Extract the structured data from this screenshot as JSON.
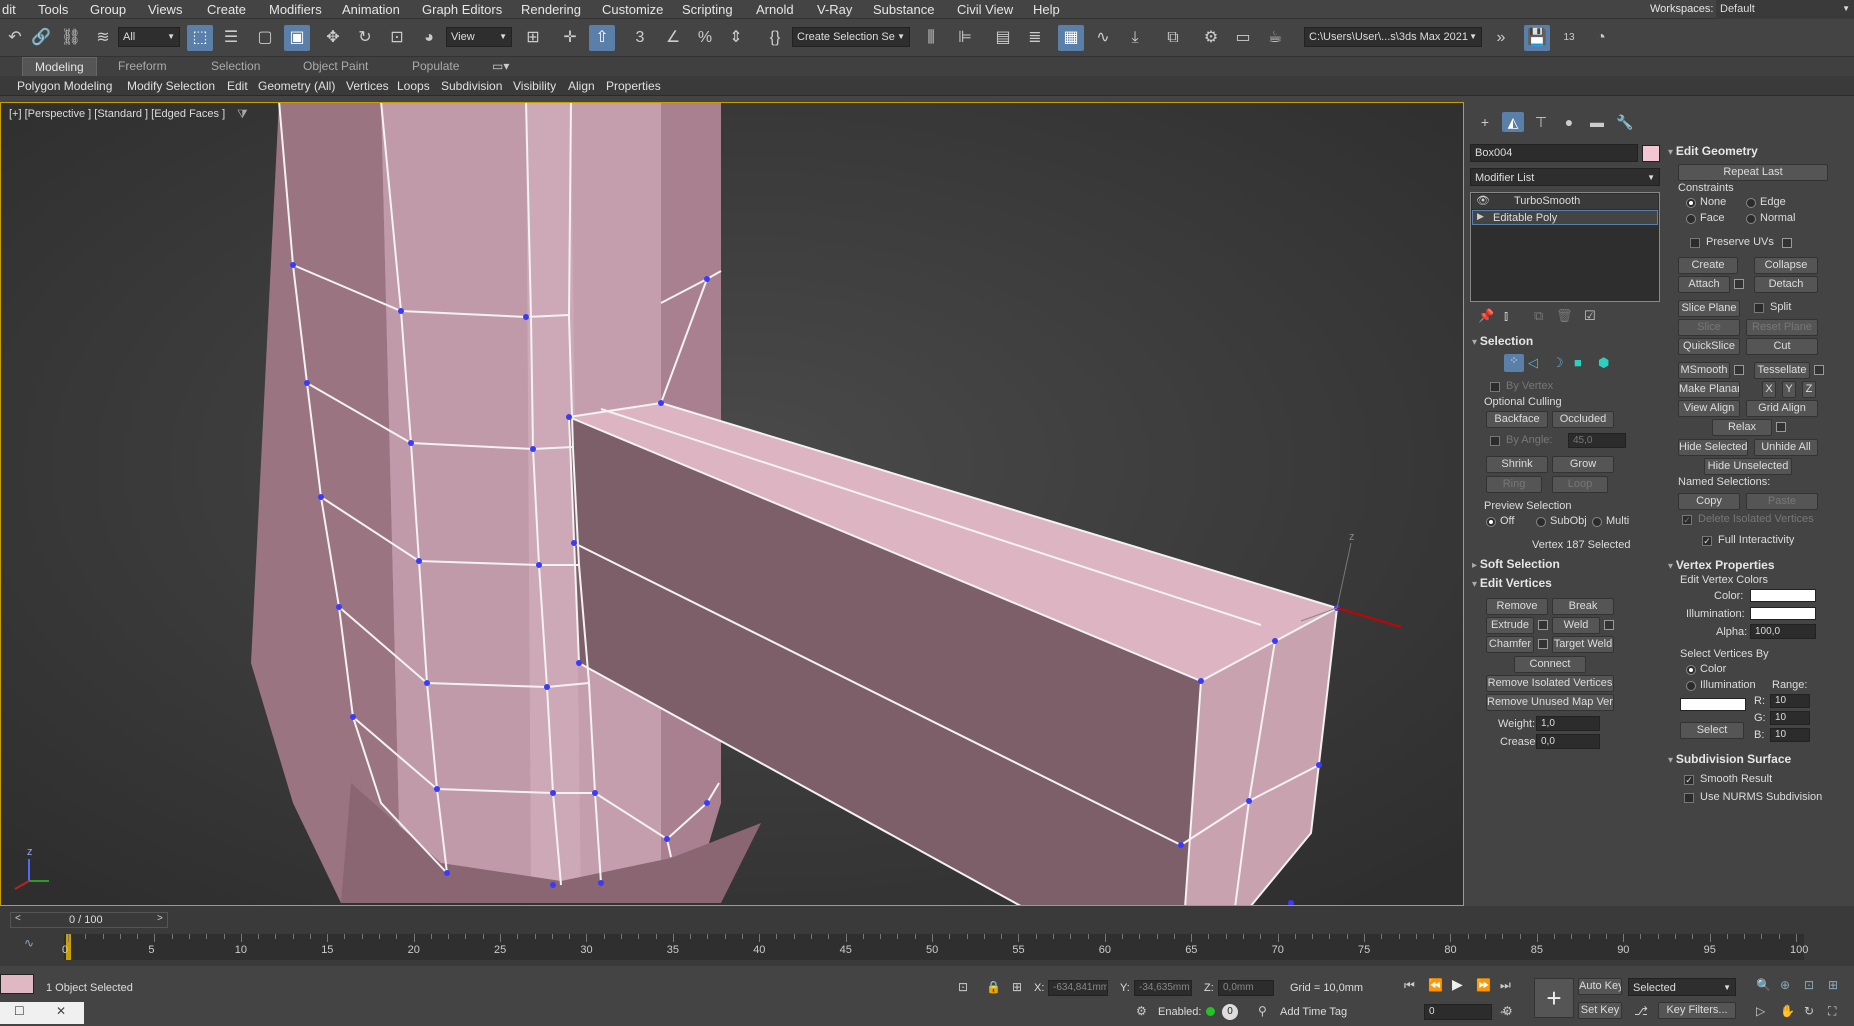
{
  "menubar": {
    "items": [
      "dit",
      "Tools",
      "Group",
      "Views",
      "Create",
      "Modifiers",
      "Animation",
      "Graph Editors",
      "Rendering",
      "Customize",
      "Scripting",
      "Arnold",
      "V-Ray",
      "Substance",
      "Civil View",
      "Help"
    ],
    "workspaces_label": "Workspaces:",
    "workspaces_value": "Default"
  },
  "toolbar": {
    "selection_filter": "All",
    "ref_coord": "View",
    "named_selection": "Create Selection Se",
    "project_path": "C:\\Users\\User\\...s\\3ds Max 2021",
    "snap_value": "3",
    "badge_13": "13"
  },
  "ribbon": {
    "tabs": [
      "Modeling",
      "Freeform",
      "Selection",
      "Object Paint",
      "Populate"
    ],
    "items": [
      "Polygon Modeling",
      "Modify Selection",
      "Edit",
      "Geometry (All)",
      "Vertices",
      "Loops",
      "Subdivision",
      "Visibility",
      "Align",
      "Properties"
    ]
  },
  "viewport": {
    "label": "[+] [Perspective ] [Standard ] [Edged Faces ]",
    "axis_z": "z",
    "gizmo_z": "z"
  },
  "command_panel": {
    "object_name": "Box004",
    "object_color": "#f3c6d3",
    "modifier_list": "Modifier List",
    "stack": [
      "TurboSmooth",
      "Editable Poly"
    ],
    "selection": {
      "title": "Selection",
      "by_vertex": "By Vertex",
      "optional_culling": "Optional Culling",
      "backface": "Backface",
      "occluded": "Occluded",
      "by_angle": "By Angle:",
      "by_angle_value": "45,0",
      "shrink": "Shrink",
      "grow": "Grow",
      "ring": "Ring",
      "loop": "Loop",
      "preview_selection": "Preview Selection",
      "off": "Off",
      "subobj": "SubObj",
      "multi": "Multi",
      "status": "Vertex 187 Selected"
    },
    "soft_selection": "Soft Selection",
    "edit_vertices": {
      "title": "Edit Vertices",
      "remove": "Remove",
      "break": "Break",
      "extrude": "Extrude",
      "weld": "Weld",
      "chamfer": "Chamfer",
      "target_weld": "Target Weld",
      "connect": "Connect",
      "remove_isolated": "Remove Isolated Vertices",
      "remove_unused": "Remove Unused Map Verts",
      "weight_label": "Weight:",
      "weight_value": "1,0",
      "crease_label": "Crease:",
      "crease_value": "0,0"
    },
    "edit_geometry": {
      "title": "Edit Geometry",
      "repeat_last": "Repeat Last",
      "constraints": "Constraints",
      "none": "None",
      "edge": "Edge",
      "face": "Face",
      "normal": "Normal",
      "preserve_uvs": "Preserve UVs",
      "create": "Create",
      "collapse": "Collapse",
      "attach": "Attach",
      "detach": "Detach",
      "slice_plane": "Slice Plane",
      "split": "Split",
      "slice": "Slice",
      "reset_plane": "Reset Plane",
      "quickslice": "QuickSlice",
      "cut": "Cut",
      "msmooth": "MSmooth",
      "tessellate": "Tessellate",
      "make_planar": "Make Planar",
      "x": "X",
      "y": "Y",
      "z": "Z",
      "view_align": "View Align",
      "grid_align": "Grid Align",
      "relax": "Relax",
      "hide_selected": "Hide Selected",
      "unhide_all": "Unhide All",
      "hide_unselected": "Hide Unselected",
      "named_selections": "Named Selections:",
      "copy": "Copy",
      "paste": "Paste",
      "delete_isolated": "Delete Isolated Vertices",
      "full_interactivity": "Full Interactivity"
    },
    "vertex_properties": {
      "title": "Vertex Properties",
      "edit_vertex_colors": "Edit Vertex Colors",
      "color": "Color:",
      "illumination": "Illumination:",
      "alpha": "Alpha:",
      "alpha_value": "100,0",
      "select_vertices_by": "Select Vertices By",
      "color_radio": "Color",
      "illumination_radio": "Illumination",
      "range": "Range:",
      "r": "R:",
      "g": "G:",
      "b": "B:",
      "r_value": "10",
      "g_value": "10",
      "b_value": "10",
      "select": "Select"
    },
    "subdivision_surface": {
      "title": "Subdivision Surface",
      "smooth_result": "Smooth Result",
      "use_nurms": "Use NURMS Subdivision"
    }
  },
  "timeline": {
    "frame": "0 / 100",
    "ticks": [
      "0",
      "5",
      "10",
      "15",
      "20",
      "25",
      "30",
      "35",
      "40",
      "45",
      "50",
      "55",
      "60",
      "65",
      "70",
      "75",
      "80",
      "85",
      "90",
      "95",
      "100"
    ]
  },
  "status": {
    "selection": "1 Object Selected",
    "x_label": "X:",
    "x_value": "-634,841mm",
    "y_label": "Y:",
    "y_value": "-34,635mm",
    "z_label": "Z:",
    "z_value": "0,0mm",
    "grid": "Grid = 10,0mm",
    "enabled": "Enabled:",
    "enabled_count": "0",
    "add_time_tag": "Add Time Tag",
    "auto_key": "Auto Key",
    "set_key": "Set Key",
    "selected": "Selected",
    "key_filters": "Key Filters...",
    "frame_field": "0"
  }
}
